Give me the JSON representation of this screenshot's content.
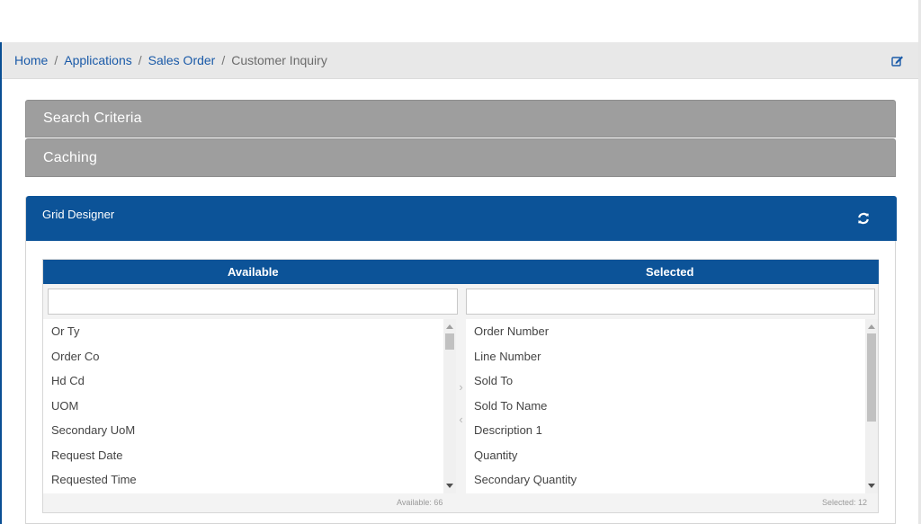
{
  "breadcrumb": {
    "items": [
      "Home",
      "Applications",
      "Sales Order"
    ],
    "current": "Customer Inquiry",
    "separator": "/",
    "edit_icon": "edit-icon"
  },
  "accordions": {
    "search_criteria": "Search Criteria",
    "caching": "Caching"
  },
  "grid_designer": {
    "title": "Grid Designer",
    "refresh_icon": "refresh-icon",
    "available": {
      "header": "Available",
      "filter_value": "",
      "items": [
        "Or Ty",
        "Order Co",
        "Hd Cd",
        "UOM",
        "Secondary UoM",
        "Request Date",
        "Requested Time"
      ],
      "count_label": "Available: 66"
    },
    "selected": {
      "header": "Selected",
      "filter_value": "",
      "items": [
        "Order Number",
        "Line Number",
        "Sold To",
        "Sold To Name",
        "Description 1",
        "Quantity",
        "Secondary Quantity"
      ],
      "count_label": "Selected: 12"
    },
    "move_right_glyph": "›",
    "move_left_glyph": "‹"
  },
  "colors": {
    "primary": "#0c5398",
    "accordion": "#9e9e9e",
    "link": "#1a5aa8"
  }
}
